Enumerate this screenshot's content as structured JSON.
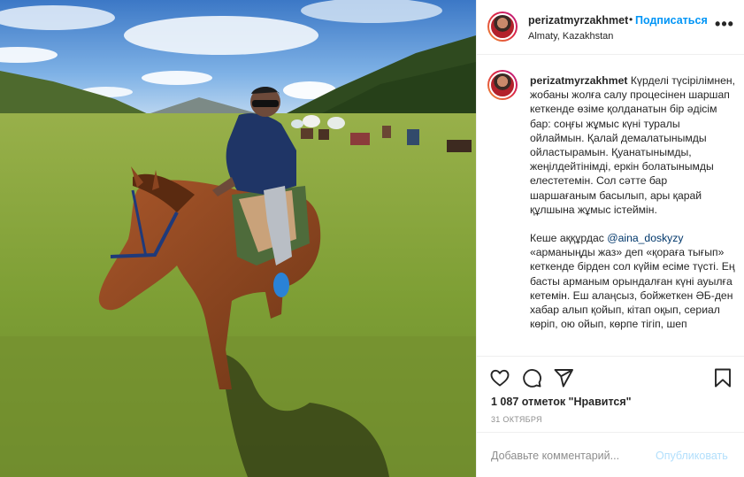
{
  "post": {
    "username": "perizatmyrzakhmet",
    "separator": "•",
    "follow_label": "Подписаться",
    "location": "Almaty, Kazakhstan",
    "more_label": "•••",
    "caption": {
      "username": "perizatmyrzakhmet",
      "paragraph1": "Күрделі түсірілімнен, жобаны жолға салу процесінен шаршап кеткенде өзіме қолданатын бір әдісім бар: соңғы жұмыс күні туралы ойлаймын. Қалай демалатынымды ойластырамын. Қуанатынымды, жеңілдейтінімді, еркін болатынымды елестетемін. Сол сәтте бар шаршағаным басылып, ары қарай құлшына жұмыс істеймін.",
      "paragraph2_before": "Кеше аққұрдас ",
      "mention": "@aina_doskyzy",
      "paragraph2_after": " «арманыңды жаз» деп «қорағa тығып» кеткенде бірден сол күйім есіме түсті. Ең басты арманым орындалған күні ауылға кетемін. Еш алаңсыз, бойжеткен ӘБ-ден хабар алып қойып, кітап оқып, сериал көріп, ою ойып, көрпе тігіп, шеп"
    },
    "likes_text": "1 087 отметок \"Нравится\"",
    "date_text": "31 ОКТЯБРЯ",
    "comment_placeholder": "Добавьте комментарий...",
    "publish_label": "Опубликовать",
    "icons": [
      "heart-icon",
      "comment-icon",
      "share-icon",
      "bookmark-icon"
    ],
    "colors": {
      "link": "#0095f6",
      "mention": "#00376b",
      "publish_disabled": "#b2dffc",
      "meta": "#8e8e8e"
    }
  }
}
